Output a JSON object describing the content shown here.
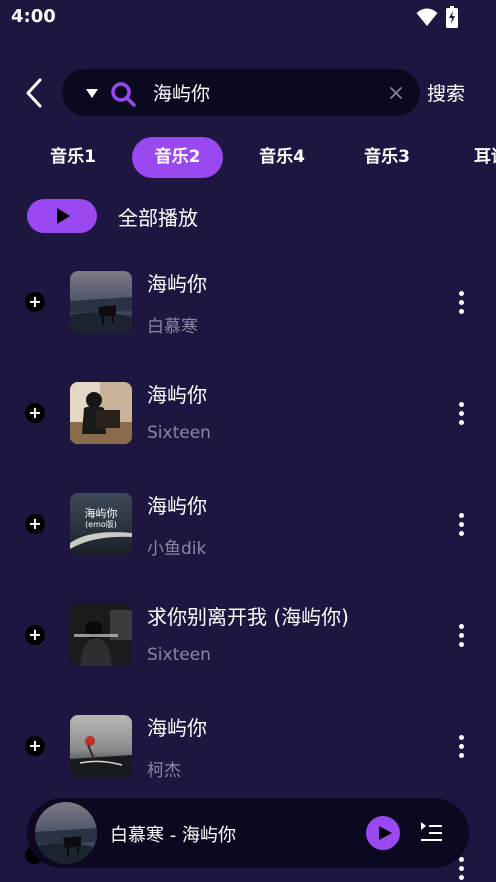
{
  "status_bar": {
    "time": "4:00",
    "icons": [
      "wifi-icon",
      "battery-charging-icon"
    ]
  },
  "search": {
    "value": "海屿你",
    "search_button_label": "搜索",
    "icons": [
      "back-arrow-icon",
      "dropdown-triangle-icon",
      "search-icon",
      "clear-icon"
    ]
  },
  "tabs": [
    {
      "label": "音乐1",
      "active": false
    },
    {
      "label": "音乐2",
      "active": true
    },
    {
      "label": "音乐4",
      "active": false
    },
    {
      "label": "音乐3",
      "active": false
    },
    {
      "label": "耳语",
      "active": false
    }
  ],
  "play_all": {
    "label": "全部播放"
  },
  "songs": [
    {
      "title": "海屿你",
      "artist": "白慕寒"
    },
    {
      "title": "海屿你",
      "artist": "Sixteen"
    },
    {
      "title": "海屿你",
      "artist": "小鱼dik",
      "cover_text": "海屿你",
      "cover_subtext": "(emo版)"
    },
    {
      "title": "求你别离开我 (海屿你)",
      "artist": "Sixteen"
    },
    {
      "title": "海屿你",
      "artist": "柯杰"
    }
  ],
  "player": {
    "now_playing": "白慕寒 - 海屿你",
    "icons": [
      "play-icon",
      "playlist-icon"
    ]
  },
  "colors": {
    "background": "#1d1640",
    "accent": "#9a48f0",
    "field": "#0b0920",
    "secondary_text": "#8a86a3"
  }
}
